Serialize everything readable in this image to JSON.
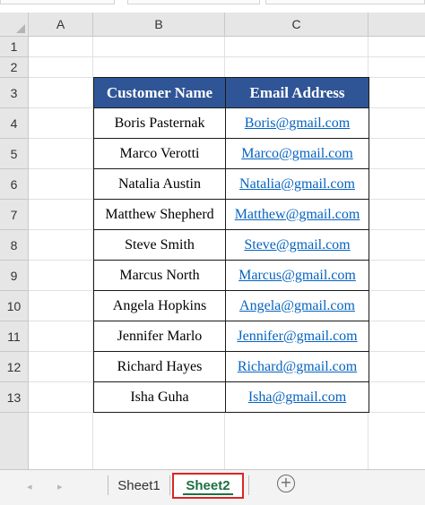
{
  "columns": [
    "A",
    "B",
    "C"
  ],
  "rows": [
    "1",
    "2",
    "3",
    "4",
    "5",
    "6",
    "7",
    "8",
    "9",
    "10",
    "11",
    "12",
    "13"
  ],
  "table": {
    "headers": [
      "Customer Name",
      "Email Address"
    ],
    "rows": [
      {
        "name": "Boris Pasternak",
        "email": "Boris@gmail.com"
      },
      {
        "name": "Marco Verotti",
        "email": "Marco@gmail.com"
      },
      {
        "name": "Natalia Austin",
        "email": "Natalia@gmail.com"
      },
      {
        "name": "Matthew Shepherd",
        "email": "Matthew@gmail.com"
      },
      {
        "name": "Steve Smith",
        "email": "Steve@gmail.com"
      },
      {
        "name": "Marcus North",
        "email": "Marcus@gmail.com"
      },
      {
        "name": "Angela Hopkins",
        "email": "Angela@gmail.com"
      },
      {
        "name": "Jennifer Marlo",
        "email": "Jennifer@gmail.com"
      },
      {
        "name": "Richard Hayes",
        "email": "Richard@gmail.com"
      },
      {
        "name": "Isha Guha",
        "email": "Isha@gmail.com"
      }
    ]
  },
  "tabs": {
    "prev": "◂",
    "next": "▸",
    "sheet1": "Sheet1",
    "sheet2": "Sheet2",
    "add": "+"
  },
  "colors": {
    "header_fill": "#2f5597",
    "link": "#0563c1",
    "active_tab": "#1d7044",
    "highlight_box": "#e02424"
  }
}
